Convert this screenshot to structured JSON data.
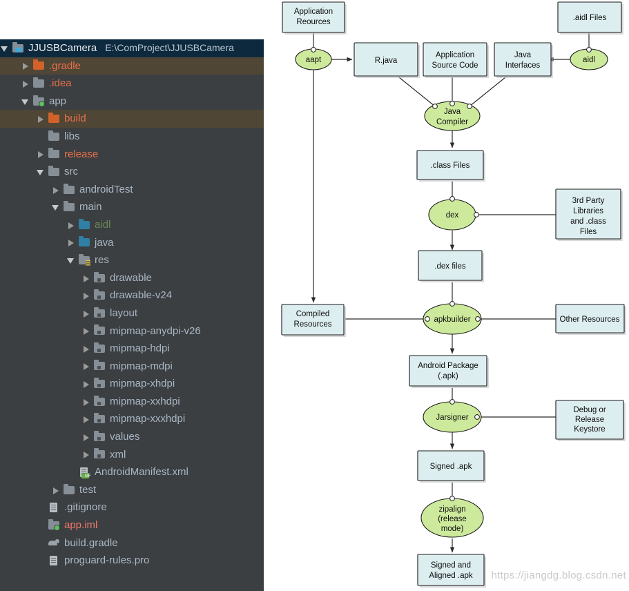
{
  "project_tree": {
    "root": {
      "label": "JJUSBCamera",
      "path": "E:\\ComProject\\JJUSBCamera",
      "icon": "project-folder-icon",
      "arrow": "chevron-down-icon",
      "selected": true
    },
    "items": [
      {
        "label": ".gradle",
        "indent": 1,
        "arrow": "chevron-right-icon",
        "icon": "folder-icon-orange",
        "color": "red",
        "highlight": "excluded"
      },
      {
        "label": ".idea",
        "indent": 1,
        "arrow": "chevron-right-icon",
        "icon": "folder-icon-grey",
        "color": "red",
        "highlight": "none"
      },
      {
        "label": "app",
        "indent": 1,
        "arrow": "chevron-down-icon",
        "icon": "module-folder-icon",
        "color": "grey",
        "highlight": "none"
      },
      {
        "label": "build",
        "indent": 2,
        "arrow": "chevron-right-icon",
        "icon": "folder-icon-orange",
        "color": "red",
        "highlight": "excluded"
      },
      {
        "label": "libs",
        "indent": 2,
        "arrow": "none",
        "icon": "folder-icon-grey",
        "color": "grey",
        "highlight": "none"
      },
      {
        "label": "release",
        "indent": 2,
        "arrow": "chevron-right-icon",
        "icon": "folder-icon-grey",
        "color": "red",
        "highlight": "none"
      },
      {
        "label": "src",
        "indent": 2,
        "arrow": "chevron-down-icon",
        "icon": "folder-icon-grey",
        "color": "grey",
        "highlight": "none"
      },
      {
        "label": "androidTest",
        "indent": 3,
        "arrow": "chevron-right-icon",
        "icon": "folder-icon-grey",
        "color": "grey",
        "highlight": "none"
      },
      {
        "label": "main",
        "indent": 3,
        "arrow": "chevron-down-icon",
        "icon": "folder-icon-grey",
        "color": "grey",
        "highlight": "none"
      },
      {
        "label": "aidl",
        "indent": 4,
        "arrow": "chevron-right-icon",
        "icon": "source-folder-icon",
        "color": "green",
        "highlight": "none"
      },
      {
        "label": "java",
        "indent": 4,
        "arrow": "chevron-right-icon",
        "icon": "source-folder-icon",
        "color": "grey",
        "highlight": "none"
      },
      {
        "label": "res",
        "indent": 4,
        "arrow": "chevron-down-icon",
        "icon": "res-folder-icon",
        "color": "grey",
        "highlight": "none"
      },
      {
        "label": "drawable",
        "indent": 5,
        "arrow": "chevron-right-icon",
        "icon": "resource-dir-icon",
        "color": "grey",
        "highlight": "none"
      },
      {
        "label": "drawable-v24",
        "indent": 5,
        "arrow": "chevron-right-icon",
        "icon": "resource-dir-icon",
        "color": "grey",
        "highlight": "none"
      },
      {
        "label": "layout",
        "indent": 5,
        "arrow": "chevron-right-icon",
        "icon": "resource-dir-icon",
        "color": "grey",
        "highlight": "none"
      },
      {
        "label": "mipmap-anydpi-v26",
        "indent": 5,
        "arrow": "chevron-right-icon",
        "icon": "resource-dir-icon",
        "color": "grey",
        "highlight": "none"
      },
      {
        "label": "mipmap-hdpi",
        "indent": 5,
        "arrow": "chevron-right-icon",
        "icon": "resource-dir-icon",
        "color": "grey",
        "highlight": "none"
      },
      {
        "label": "mipmap-mdpi",
        "indent": 5,
        "arrow": "chevron-right-icon",
        "icon": "resource-dir-icon",
        "color": "grey",
        "highlight": "none"
      },
      {
        "label": "mipmap-xhdpi",
        "indent": 5,
        "arrow": "chevron-right-icon",
        "icon": "resource-dir-icon",
        "color": "grey",
        "highlight": "none"
      },
      {
        "label": "mipmap-xxhdpi",
        "indent": 5,
        "arrow": "chevron-right-icon",
        "icon": "resource-dir-icon",
        "color": "grey",
        "highlight": "none"
      },
      {
        "label": "mipmap-xxxhdpi",
        "indent": 5,
        "arrow": "chevron-right-icon",
        "icon": "resource-dir-icon",
        "color": "grey",
        "highlight": "none"
      },
      {
        "label": "values",
        "indent": 5,
        "arrow": "chevron-right-icon",
        "icon": "resource-dir-icon",
        "color": "grey",
        "highlight": "none"
      },
      {
        "label": "xml",
        "indent": 5,
        "arrow": "chevron-right-icon",
        "icon": "resource-dir-icon",
        "color": "grey",
        "highlight": "none"
      },
      {
        "label": "AndroidManifest.xml",
        "indent": 4,
        "arrow": "none",
        "icon": "manifest-file-icon",
        "color": "grey",
        "highlight": "none",
        "badge": "MF"
      },
      {
        "label": "test",
        "indent": 3,
        "arrow": "chevron-right-icon",
        "icon": "folder-icon-grey",
        "color": "grey",
        "highlight": "none"
      },
      {
        "label": ".gitignore",
        "indent": 2,
        "arrow": "none",
        "icon": "text-file-icon",
        "color": "grey",
        "highlight": "none"
      },
      {
        "label": "app.iml",
        "indent": 2,
        "arrow": "none",
        "icon": "module-folder-icon",
        "color": "salmon",
        "highlight": "none"
      },
      {
        "label": "build.gradle",
        "indent": 2,
        "arrow": "none",
        "icon": "gradle-file-icon",
        "color": "grey",
        "highlight": "none"
      },
      {
        "label": "proguard-rules.pro",
        "indent": 2,
        "arrow": "none",
        "icon": "text-file-icon",
        "color": "grey",
        "highlight": "none"
      }
    ]
  },
  "flow_diagram": {
    "watermark": "https://jiangdg.blog.csdn.net",
    "colors": {
      "box_fill": "#ddeef0",
      "ellipse_fill": "#cdea9c",
      "stroke": "#1a1a1a"
    },
    "nodes": {
      "application_resources": "Application\nReources",
      "application_resources_l1": "Application",
      "application_resources_l2": "Reources",
      "aapt": "aapt",
      "r_java": "R.java",
      "application_source_code_l1": "Application",
      "application_source_code_l2": "Source Code",
      "java_interfaces_l1": "Java",
      "java_interfaces_l2": "Interfaces",
      "aidl_files": ".aidl Files",
      "aidl": "aidl",
      "java_compiler_l1": "Java",
      "java_compiler_l2": "Compiler",
      "class_files": ".class Files",
      "dex": "dex",
      "third_party_l1": "3rd Party",
      "third_party_l2": "Libraries",
      "third_party_l3": "and .class",
      "third_party_l4": "Files",
      "dex_files": ".dex files",
      "compiled_resources_l1": "Compiled",
      "compiled_resources_l2": "Resources",
      "apkbuilder": "apkbuilder",
      "other_resources": "Other Resources",
      "android_package_l1": "Android Package",
      "android_package_l2": "(.apk)",
      "jarsigner": "Jarsigner",
      "keystore_l1": "Debug or",
      "keystore_l2": "Release",
      "keystore_l3": "Keystore",
      "signed_apk": "Signed .apk",
      "zipalign_l1": "zipalign",
      "zipalign_l2": "(release",
      "zipalign_l3": "mode)",
      "signed_aligned_l1": "Signed and",
      "signed_aligned_l2": "Aligned .apk"
    }
  }
}
